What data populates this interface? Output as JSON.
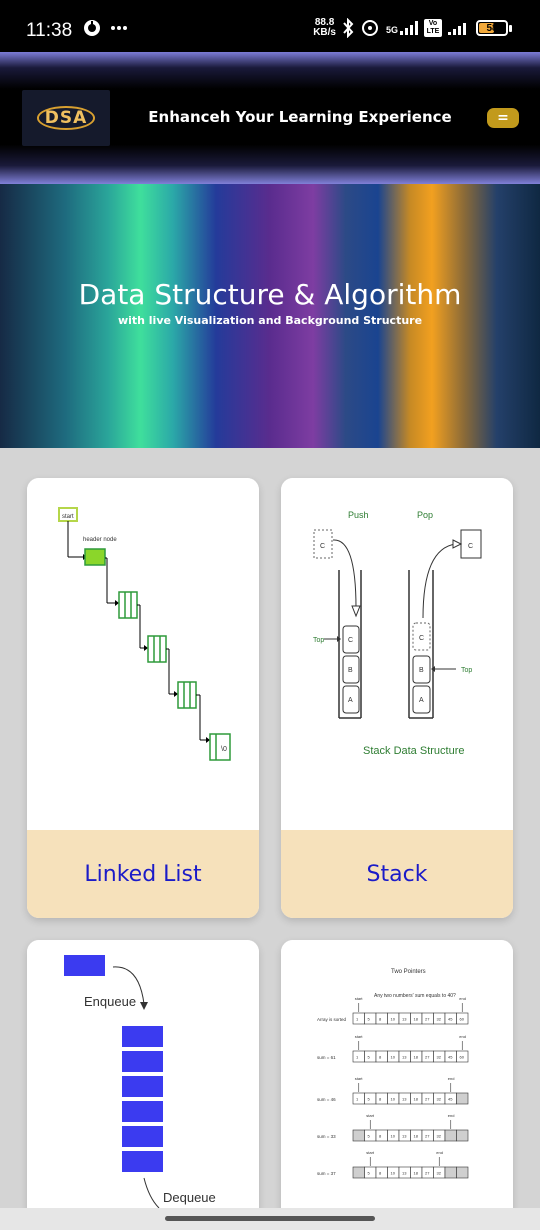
{
  "status_bar": {
    "time": "11:38",
    "net_speed_value": "88.8",
    "net_speed_unit": "KB/s",
    "network": "5G",
    "volte": "Vo LTE",
    "battery": "58"
  },
  "header": {
    "logo_text": "DSA",
    "title": "Enhanceh Your Learning Experience",
    "menu_icon": "="
  },
  "hero": {
    "title": "Data Structure & Algorithm",
    "subtitle": "with live Visualization and Background Structure"
  },
  "cards": [
    {
      "label": "Linked List"
    },
    {
      "label": "Stack"
    },
    {
      "label": ""
    },
    {
      "label": ""
    }
  ],
  "linked_list_image": {
    "start": "start",
    "header_node": "header node",
    "null_label": "\\0"
  },
  "stack_image": {
    "push": "Push",
    "pop": "Pop",
    "top": "Top",
    "c": "C",
    "b": "B",
    "a": "A",
    "caption": "Stack Data Structure"
  },
  "queue_image": {
    "enqueue": "Enqueue",
    "dequeue": "Dequeue"
  },
  "two_pointers_image": {
    "title": "Two Pointers",
    "question": "Any two numbers' sum equals to 40?",
    "array_label": "Array is sorted",
    "values": [
      "1",
      "5",
      "8",
      "10",
      "13",
      "18",
      "27",
      "32",
      "45",
      "60"
    ],
    "rows": [
      {
        "label": "",
        "start": "start",
        "end": "end"
      },
      {
        "label": "sum = 61",
        "start": "start",
        "end": "end"
      },
      {
        "label": "sum = 46",
        "start": "start",
        "end": "end"
      },
      {
        "label": "sum = 33",
        "start": "start",
        "end": "end"
      },
      {
        "label": "sum = 37",
        "start": "start",
        "end": "end"
      }
    ]
  },
  "colors": {
    "accent_label": "#1b1bc8",
    "label_band": "#f6e1bb",
    "menu_button": "#c29a1c",
    "queue_block": "#3b3bf0"
  }
}
